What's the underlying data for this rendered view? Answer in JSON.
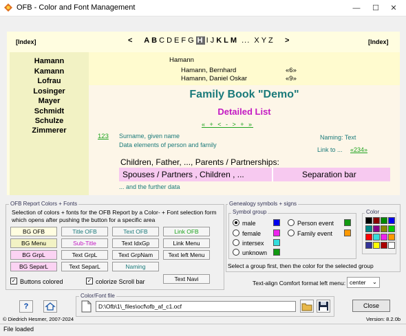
{
  "window": {
    "title": "OFB - Color and Font Management",
    "minimize": "—",
    "maximize": "☐",
    "close": "✕"
  },
  "nav": {
    "index_left": "[Index]",
    "index_right": "[Index]",
    "prev": "<",
    "next": ">",
    "letters_bold1": [
      "A",
      "B",
      "C",
      "D",
      "E",
      "F",
      "G"
    ],
    "current": "H",
    "letters2": [
      "I",
      "J"
    ],
    "letters_bold2": [
      "K",
      "L",
      "M"
    ],
    "ellipsis": "...",
    "letters3": [
      "X",
      "Y",
      "Z"
    ]
  },
  "surnames": [
    "Hamann",
    "Kamann",
    "Lofrau",
    "Losinger",
    "Mayer",
    "Schmidt",
    "Schulze",
    "Zimmerer"
  ],
  "namelist": {
    "heading": "Hamann",
    "entries": [
      {
        "name": "Hamann, Bernhard",
        "ref": "«6»"
      },
      {
        "name": "Hamann, Daniel Oskar",
        "ref": "«9»"
      }
    ]
  },
  "book": {
    "title": "Family Book \"Demo\"",
    "subtitle": "Detailed List",
    "navsymbols": "« + < - > + »"
  },
  "person": {
    "link_num": "123",
    "line1": "Surname, given name",
    "line2": "Data elements of person and family",
    "naming": "Naming: Text",
    "link_to": "Link to ...",
    "link_ref": "«234»",
    "children_line": "Children, Father, ..., Parents / Partnerships:",
    "spouses": "Spouses / Partners , Children , ...",
    "separation": "Separation bar",
    "further": "... and the further data"
  },
  "colors_panel": {
    "title": "OFB Report Colors + Fonts",
    "desc": "Selection of colors + fonts for the OFB Report by a Color- + Font selection form which opens after pushing the button for a specific area",
    "buttons": [
      {
        "label": "BG OFB",
        "bg": "#fffde0"
      },
      {
        "label": "Title OFB",
        "bg": "#f5f5f5",
        "color": "#1a7a7a"
      },
      {
        "label": "Text OFB",
        "bg": "#f5f5f5",
        "color": "#1a7a7a"
      },
      {
        "label": "Link OFB",
        "bg": "#f5f5f5",
        "color": "#1ea31e"
      },
      {
        "label": "BG Menu",
        "bg": "#f2f2c4"
      },
      {
        "label": "Sub-Title",
        "bg": "#f5f5f5",
        "color": "#c31ac3"
      },
      {
        "label": "Text IdxGp",
        "bg": "#f5f5f5"
      },
      {
        "label": "Link Menu",
        "bg": "#f5f5f5"
      },
      {
        "label": "BG GrpL",
        "bg": "#fbd3f3"
      },
      {
        "label": "Text GrpL",
        "bg": "#f5f5f5"
      },
      {
        "label": "Text GrpNam",
        "bg": "#f5f5f5"
      },
      {
        "label": "Text left Menu",
        "bg": "#f5f5f5"
      },
      {
        "label": "BG SeparL",
        "bg": "#fbd3f3"
      },
      {
        "label": "Text SeparL",
        "bg": "#f5f5f5"
      },
      {
        "label": "Naming",
        "bg": "#f5f5f5",
        "color": "#1a7a7a"
      },
      {
        "label": "Text Navi",
        "bg": "#f5f5f5"
      }
    ],
    "chk_buttons_colored": "Buttons colored",
    "chk_colorize_scroll": "colorize Scroll bar"
  },
  "genealogy": {
    "title": "Genealogy symbols + signs",
    "symbol_group": "Symbol group",
    "options": [
      {
        "label": "male",
        "color": "#0000ee",
        "checked": true
      },
      {
        "label": "female",
        "color": "#ee22ee",
        "checked": false
      },
      {
        "label": "intersex",
        "color": "#33dddd",
        "checked": false
      },
      {
        "label": "unknown",
        "color": "#119911",
        "checked": false
      }
    ],
    "options2": [
      {
        "label": "Person event",
        "color": "#119911"
      },
      {
        "label": "Family event",
        "color": "#ff9900"
      }
    ],
    "color_title": "Color",
    "palette": [
      "#000000",
      "#880000",
      "#008800",
      "#0000ee",
      "#008888",
      "#880088",
      "#888800",
      "#00cc00",
      "#ff0000",
      "#33dddd",
      "#ee22ee",
      "#ff9900",
      "#333399",
      "#ffff00",
      "#aa0000",
      "#ffffff"
    ],
    "hint": "Select a group first, then the color for the selected group"
  },
  "textalign": {
    "label": "Text-align Comfort format left menu:",
    "value": "center"
  },
  "file": {
    "group": "Color/Font file",
    "path": "D:\\Ofb\\1\\_files\\ocf\\ofb_af_c1.ocf"
  },
  "footer": {
    "copyright": "© Diedrich Hesmer,  2007-2024",
    "version": "Version: 8.2.0b",
    "close": "Close",
    "status": "File loaded"
  }
}
